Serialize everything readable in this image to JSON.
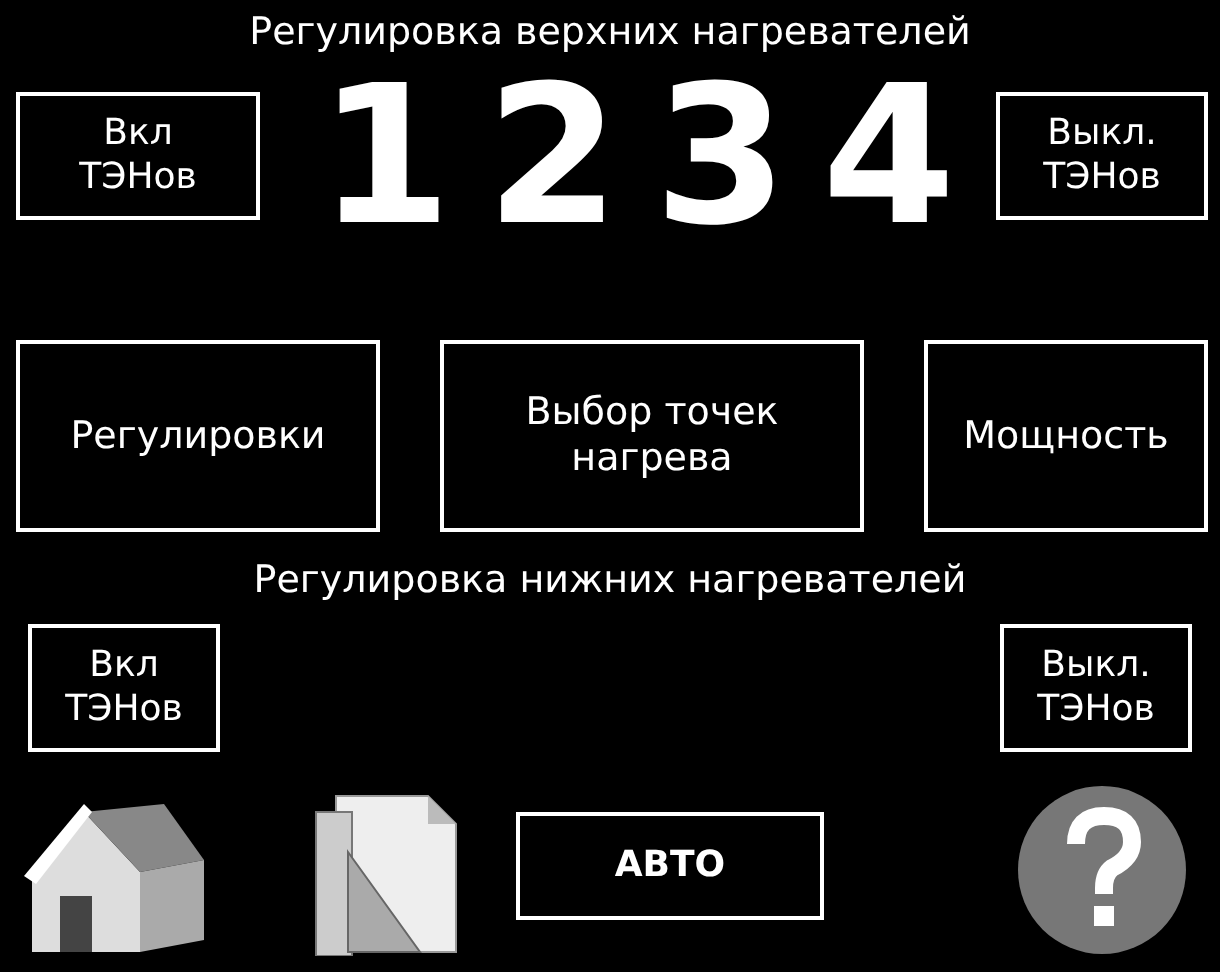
{
  "upper": {
    "title": "Регулировка верхних нагревателей",
    "on_button": "Вкл\nТЭНов",
    "off_button": "Выкл.\nТЭНов",
    "digits": [
      "1",
      "2",
      "3",
      "4"
    ]
  },
  "middle_buttons": [
    "Регулировки",
    "Выбор точек\nнагрева",
    "Мощность"
  ],
  "lower": {
    "title": "Регулировка нижних нагревателей",
    "on_button": "Вкл\nТЭНов",
    "off_button": "Выкл.\nТЭНов"
  },
  "bottom": {
    "auto_button": "АВТО"
  }
}
